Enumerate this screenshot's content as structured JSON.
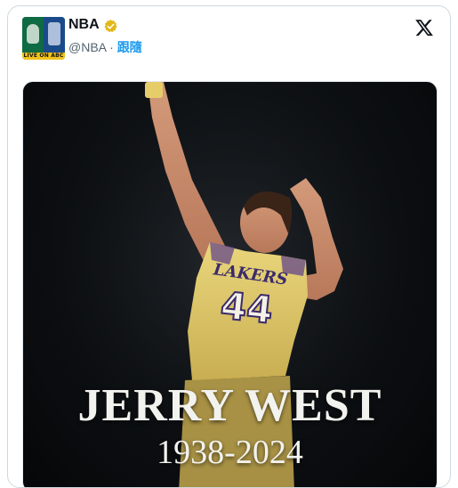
{
  "account": {
    "name": "NBA",
    "handle": "@NBA",
    "separator": "·",
    "follow_label": "跟隨",
    "avatar_caption": "LIVE ON ABC",
    "verified_icon": "verified-badge-icon"
  },
  "header": {
    "close_icon": "x-logo-icon"
  },
  "media": {
    "headline": "JERRY WEST",
    "years": "1938-2024",
    "jersey_text": "LAKERS",
    "jersey_number": "44"
  },
  "colors": {
    "verified": "#e2b719",
    "follow": "#1d9bf0",
    "jersey": "#e6cf72",
    "jersey_number": "#3a2a6b"
  }
}
